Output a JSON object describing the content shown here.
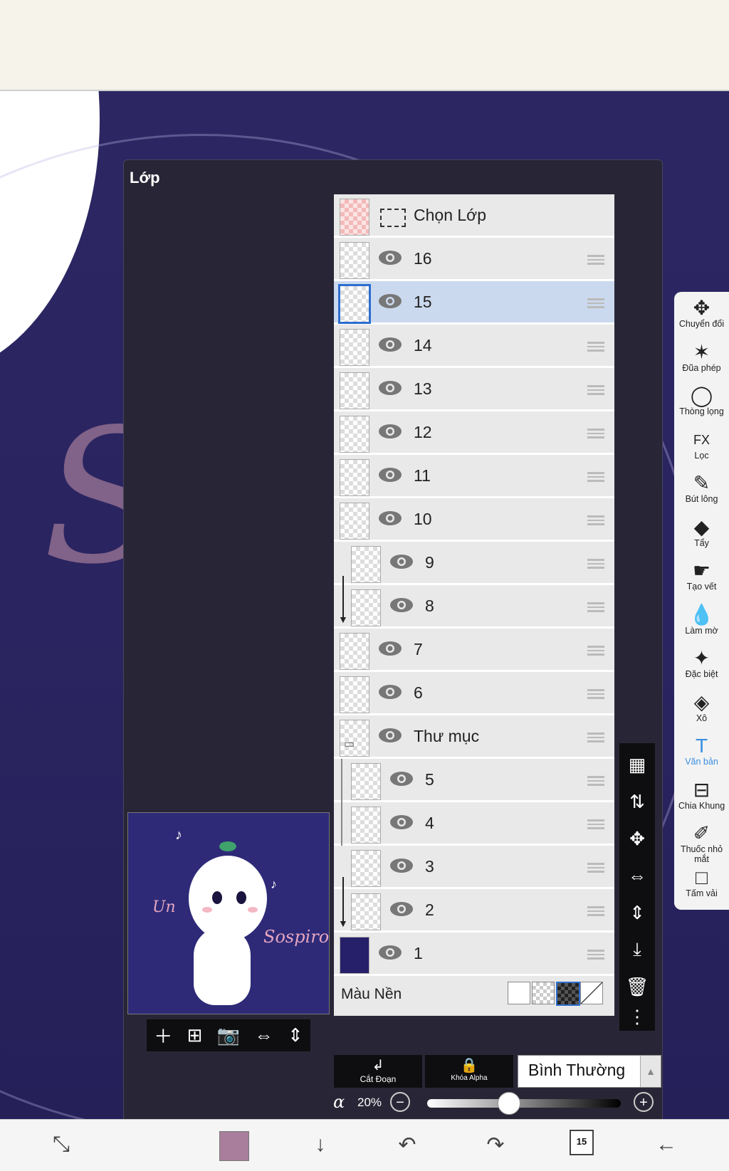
{
  "panel": {
    "title": "Lớp"
  },
  "layers": [
    {
      "name": "Chọn Lớp",
      "kind": "selection"
    },
    {
      "name": "16"
    },
    {
      "name": "15",
      "selected": true
    },
    {
      "name": "14"
    },
    {
      "name": "13"
    },
    {
      "name": "12"
    },
    {
      "name": "11"
    },
    {
      "name": "10"
    },
    {
      "name": "9",
      "clipped": true
    },
    {
      "name": "8",
      "clipped": true
    },
    {
      "name": "7"
    },
    {
      "name": "6"
    },
    {
      "name": "Thư mục",
      "kind": "folder"
    },
    {
      "name": "5",
      "in_folder": true
    },
    {
      "name": "4",
      "in_folder": true
    },
    {
      "name": "3",
      "clipped": true
    },
    {
      "name": "2",
      "clipped": true
    },
    {
      "name": "1",
      "fill": "#26206a"
    }
  ],
  "background": {
    "label": "Màu Nền"
  },
  "actions": {
    "clip": "Cắt Đoạn",
    "alpha_lock": "Khóa Alpha"
  },
  "blend_mode": "Bình Thường",
  "opacity": {
    "symbol": "α",
    "value": "20%",
    "fraction": 0.2
  },
  "tools": [
    {
      "label": "Chuyển đổi",
      "icon": "move-icon"
    },
    {
      "label": "Đũa phép",
      "icon": "magic-wand-icon"
    },
    {
      "label": "Thòng lọng",
      "icon": "lasso-icon"
    },
    {
      "label": "Lọc",
      "icon": "fx-filter-icon"
    },
    {
      "label": "Bút lông",
      "icon": "brush-icon"
    },
    {
      "label": "Tẩy",
      "icon": "eraser-icon"
    },
    {
      "label": "Tạo vết",
      "icon": "smudge-icon"
    },
    {
      "label": "Làm mờ",
      "icon": "blur-icon"
    },
    {
      "label": "Đặc biệt",
      "icon": "special-icon"
    },
    {
      "label": "Xô",
      "icon": "bucket-icon"
    },
    {
      "label": "Văn bản",
      "icon": "text-icon",
      "active": true
    },
    {
      "label": "Chia Khung",
      "icon": "frame-divider-icon"
    },
    {
      "label": "Thuốc nhỏ mắt",
      "icon": "eyedropper-icon"
    },
    {
      "label": "Tấm vải",
      "icon": "canvas-icon"
    }
  ],
  "bottom": {
    "layer_count": "15",
    "color": "#a97e9c"
  },
  "colors": {
    "accent": "#3a8fe0",
    "selected_row": "#cbd9ee",
    "canvas_bg": "#2a2460"
  }
}
